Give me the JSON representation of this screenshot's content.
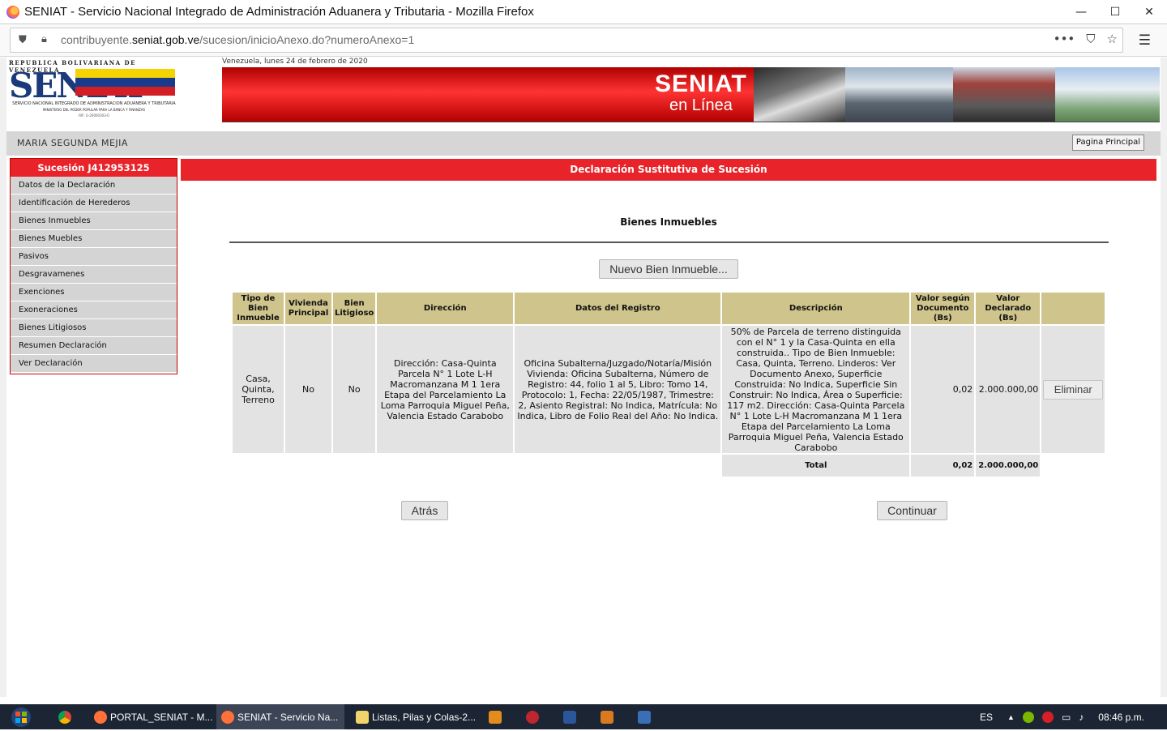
{
  "window": {
    "title": "SENIAT - Servicio Nacional Integrado de Administración Aduanera y Tributaria - Mozilla Firefox",
    "minimize": "—",
    "maximize": "☐",
    "close": "✕"
  },
  "browser": {
    "url_prefix": "contribuyente.",
    "url_domain": "seniat.gob.ve",
    "url_path": "/sucesion/inicioAnexo.do?numeroAnexo=1",
    "more_icon": "•••",
    "pocket_icon": "⛉",
    "star_icon": "☆",
    "menu_icon": "☰"
  },
  "header": {
    "logo_top": "REPUBLICA BOLIVARIANA DE VENEZUELA",
    "logo_main": "SENIAT",
    "logo_sub": "SERVICIO NACIONAL INTEGRADO DE ADMINISTRACION ADUANERA Y TRIBUTARIA",
    "logo_sub2": "MINISTERIO DEL PODER POPULAR PARA LA BANCA Y FINANZAS",
    "logo_rif": "RIF: G-20000303-0",
    "date": "Venezuela, lunes 24 de febrero de 2020",
    "banner_line1": "SENIAT",
    "banner_line2": "en Línea"
  },
  "userbar": {
    "user_name": "MARIA SEGUNDA MEJIA",
    "home_button": "Pagina Principal"
  },
  "sidebar": {
    "title": "Sucesión J412953125",
    "items": [
      {
        "label": "Datos de la Declaración"
      },
      {
        "label": "Identificación de Herederos"
      },
      {
        "label": "Bienes Inmuebles"
      },
      {
        "label": "Bienes Muebles"
      },
      {
        "label": "Pasivos"
      },
      {
        "label": "Desgravamenes"
      },
      {
        "label": "Exenciones"
      },
      {
        "label": "Exoneraciones"
      },
      {
        "label": "Bienes Litigiosos"
      },
      {
        "label": "Resumen Declaración"
      },
      {
        "label": "Ver Declaración"
      }
    ]
  },
  "main": {
    "header": "Declaración Sustitutiva de Sucesión",
    "section_title": "Bienes Inmuebles",
    "new_button": "Nuevo Bien Inmueble...",
    "columns": [
      "Tipo de Bien Inmueble",
      "Vivienda Principal",
      "Bien Litigioso",
      "Dirección",
      "Datos del Registro",
      "Descripción",
      "Valor según Documento (Bs)",
      "Valor Declarado (Bs)"
    ],
    "rows": [
      {
        "tipo": "Casa, Quinta, Terreno",
        "vivienda": "No",
        "litigioso": "No",
        "direccion": "Dirección: Casa-Quinta Parcela N° 1 Lote L-H Macromanzana M 1 1era Etapa del Parcelamiento La Loma Parroquia Miguel Peña, Valencia Estado Carabobo",
        "registro": "Oficina Subalterna/Juzgado/Notaría/Misión Vivienda: Oficina Subalterna, Número de Registro: 44, folio 1 al 5, Libro: Tomo 14, Protocolo: 1, Fecha: 22/05/1987, Trimestre: 2, Asiento Registral: No Indica, Matrícula: No Indica, Libro de Folio Real del Año: No Indica.",
        "descripcion": "50% de Parcela de terreno distinguida con el N° 1 y la Casa-Quinta en ella construida.. Tipo de Bien Inmueble: Casa, Quinta, Terreno. Linderos: Ver Documento Anexo, Superficie Construida: No Indica, Superficie Sin Construir: No Indica, Área o Superficie: 117 m2. Dirección: Casa-Quinta Parcela N° 1 Lote L-H Macromanzana M 1 1era Etapa del Parcelamiento La Loma Parroquia Miguel Peña, Valencia Estado Carabobo",
        "valor_documento": "0,02",
        "valor_declarado": "2.000.000,00",
        "action": "Eliminar"
      }
    ],
    "total_label": "Total",
    "total_documento": "0,02",
    "total_declarado": "2.000.000,00",
    "back_button": "Atrás",
    "continue_button": "Continuar"
  },
  "taskbar": {
    "items": [
      {
        "label": "PORTAL_SENIAT - M..."
      },
      {
        "label": "SENIAT - Servicio Na..."
      },
      {
        "label": "Listas, Pilas y Colas-2..."
      }
    ],
    "lang": "ES",
    "time": "08:46 p.m."
  }
}
